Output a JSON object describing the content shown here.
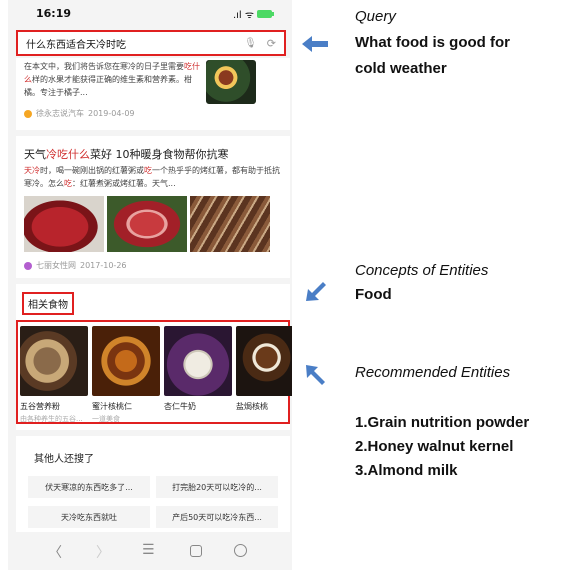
{
  "status_bar": {
    "time": "16:19",
    "signal": ".ıl ᯤ"
  },
  "search": {
    "query": "什么东西适合天冷时吃"
  },
  "result1": {
    "snippet_pre": "在本文中，我们将告诉您在寒冷的日子里需要",
    "snippet_hl": "吃什么",
    "snippet_post": "样的水果才能获得正确的维生素和营养素。柑橘。专注于橘子...",
    "source": "徐永志说汽车",
    "date": "2019-04-09"
  },
  "result2": {
    "title_pre": "天气",
    "title_hl": "冷吃什么",
    "title_post": "菜好 10种暖身食物帮你抗寒",
    "snippet_hl1": "天冷",
    "snippet_mid1": "时，喝一碗刚出锅的红薯粥或",
    "snippet_hl2": "吃",
    "snippet_mid2": "一个热乎乎的烤红薯，都有助于抵抗寒冷。怎么",
    "snippet_hl3": "吃",
    "snippet_post": "：红薯煮粥或烤红薯。天气...",
    "source": "七丽女性网",
    "date": "2017-10-26"
  },
  "related": {
    "label": "相关食物",
    "items": [
      {
        "name": "五谷营养粉",
        "sub": "由各种养生的五谷...",
        "image": "grain-powder"
      },
      {
        "name": "蜜汁核桃仁",
        "sub": "一道美食",
        "image": "honey-walnut"
      },
      {
        "name": "杏仁牛奶",
        "sub": "",
        "image": "almond-milk"
      },
      {
        "name": "盐焗核桃",
        "sub": "",
        "image": "salted-walnut"
      }
    ]
  },
  "others": {
    "title": "其他人还搜了",
    "pills": [
      "伏天寒凉的东西吃多了...",
      "打完胎20天可以吃冷的...",
      "天冷吃东西就吐",
      "产后50天可以吃冷东西..."
    ]
  },
  "nav": {
    "back": "〈",
    "forward": "〉",
    "menu": "☰"
  },
  "annotations": {
    "query": {
      "heading": "Query",
      "body_line1": "What food is good for",
      "body_line2": "cold weather"
    },
    "concepts": {
      "heading": "Concepts of  Entities",
      "body": "Food"
    },
    "recommended": {
      "heading": "Recommended Entities",
      "items": [
        "1.Grain nutrition powder",
        "2.Honey walnut kernel",
        "3.Almond milk"
      ]
    }
  },
  "colors": {
    "highlight_box": "#e02020",
    "arrow": "#4a7ec6",
    "keyword": "#d03030"
  }
}
